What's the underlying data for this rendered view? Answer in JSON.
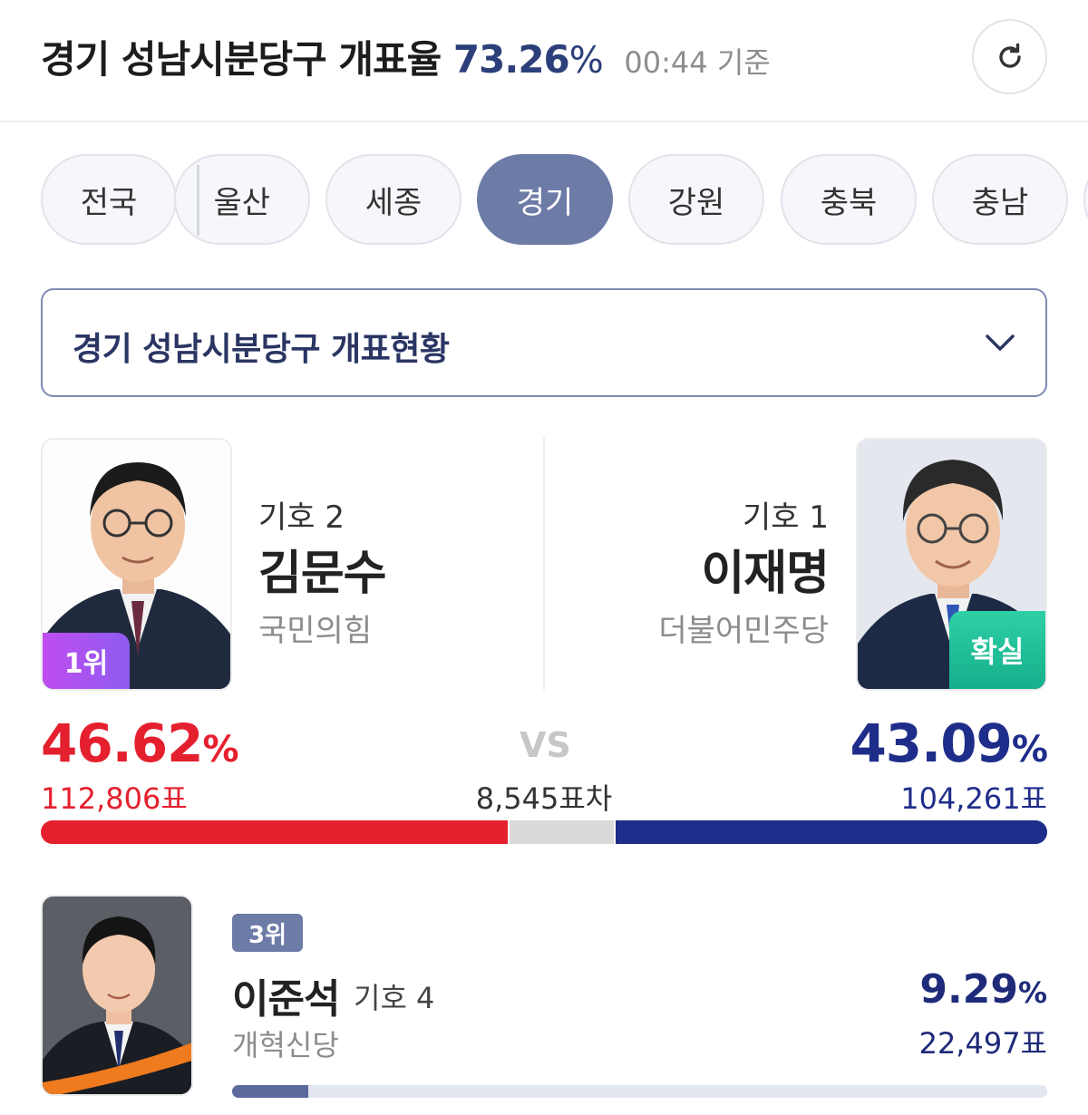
{
  "header": {
    "title": "경기 성남시분당구 개표율",
    "rate": "73.26",
    "rate_unit": "%",
    "time": "00:44 기준"
  },
  "tabs": [
    {
      "label": "전국",
      "active": false
    },
    {
      "label": "울산",
      "active": false
    },
    {
      "label": "세종",
      "active": false
    },
    {
      "label": "경기",
      "active": true
    },
    {
      "label": "강원",
      "active": false
    },
    {
      "label": "충북",
      "active": false
    },
    {
      "label": "충남",
      "active": false
    }
  ],
  "dropdown": {
    "label": "경기 성남시분당구 개표현황"
  },
  "candidates": {
    "left": {
      "number_label": "기호 2",
      "name": "김문수",
      "party": "국민의힘",
      "badge": "1위",
      "percent": "46.62",
      "percent_unit": "%",
      "votes": "112,806표",
      "color": "#e5202e",
      "share": 0.4662
    },
    "right": {
      "number_label": "기호 1",
      "name": "이재명",
      "party": "더불어민주당",
      "badge": "확실",
      "percent": "43.09",
      "percent_unit": "%",
      "votes": "104,261표",
      "color": "#1f2d8a",
      "share": 0.4309
    },
    "vs_label": "VS",
    "margin_label": "8,545표차",
    "gap_color": "#d9d9d9"
  },
  "third": {
    "rank": "3위",
    "name": "이준석",
    "number_label": "기호 4",
    "party": "개혁신당",
    "percent": "9.29",
    "percent_unit": "%",
    "votes": "22,497표",
    "share": 0.0929
  },
  "icons": {
    "refresh": "refresh-icon",
    "dropdown": "chevron-down-icon"
  }
}
